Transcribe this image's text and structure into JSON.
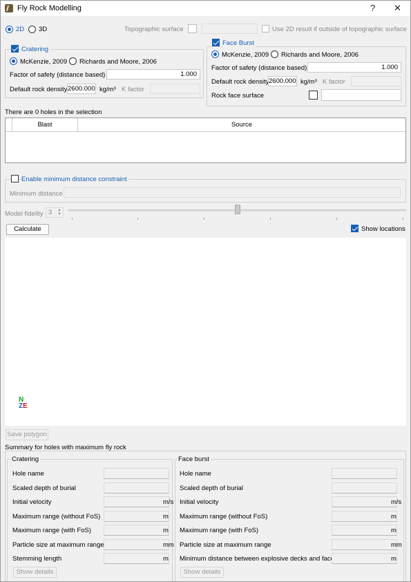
{
  "window": {
    "title": "Fly Rock Modelling",
    "help": "?",
    "close": "✕"
  },
  "mode": {
    "opt_2d": "2D",
    "opt_3d": "3D",
    "selected": "2D"
  },
  "topo": {
    "label": "Topographic surface",
    "use2d_label": "Use 2D result if outside of topographic surface"
  },
  "cratering": {
    "title": "Cratering",
    "enabled": true,
    "method1": "McKenzie, 2009",
    "method2": "Richards and Moore, 2006",
    "fos_label": "Factor of safety (distance based)",
    "fos_value": "1.000",
    "density_label": "Default rock density",
    "density_value": "2600.000",
    "density_unit": "kg/m³",
    "kfactor_label": "K factor"
  },
  "faceburst": {
    "title": "Face Burst",
    "enabled": true,
    "method1": "McKenzie, 2009",
    "method2": "Richards and Moore, 2006",
    "fos_label": "Factor of safety (distance based)",
    "fos_value": "1.000",
    "density_label": "Default rock density",
    "density_value": "2600.000",
    "density_unit": "kg/m³",
    "kfactor_label": "K factor",
    "rockface_label": "Rock face surface"
  },
  "selection": {
    "count_text": "There are 0 holes in the selection",
    "col_blast": "Blast",
    "col_source": "Source"
  },
  "mindist": {
    "enable_label": "Enable minimum distance constraint",
    "label": "Minimum distance"
  },
  "fidelity": {
    "label": "Model fidelity",
    "value": "3",
    "slider_level": 0.5
  },
  "actions": {
    "calculate": "Calculate",
    "show_locations": "Show locations",
    "save_polygon": "Save polygon"
  },
  "compass": {
    "n": "N",
    "z": "Z",
    "e": "E"
  },
  "summary": {
    "title": "Summary for holes with maximum fly rock",
    "cratering": {
      "title": "Cratering",
      "rows": [
        {
          "label": "Hole name",
          "unit": ""
        },
        {
          "label": "Scaled depth of burial",
          "unit": ""
        },
        {
          "label": "Initial velocity",
          "unit": "m/s"
        },
        {
          "label": "Maximum range (without FoS)",
          "unit": "m"
        },
        {
          "label": "Maximum range (with FoS)",
          "unit": "m"
        },
        {
          "label": "Particle size at maximum range",
          "unit": "mm"
        },
        {
          "label": "Stemming length",
          "unit": "m"
        }
      ],
      "details": "Show details"
    },
    "faceburst": {
      "title": "Face burst",
      "rows": [
        {
          "label": "Hole name",
          "unit": ""
        },
        {
          "label": "Scaled depth of burial",
          "unit": ""
        },
        {
          "label": "Initial velocity",
          "unit": "m/s"
        },
        {
          "label": "Maximum range (without FoS)",
          "unit": "m"
        },
        {
          "label": "Maximum range (with FoS)",
          "unit": "m"
        },
        {
          "label": "Particle size at maximum range",
          "unit": "mm"
        },
        {
          "label": "Minimum distance between explosive decks and face",
          "unit": "m"
        }
      ],
      "details": "Show details"
    }
  }
}
